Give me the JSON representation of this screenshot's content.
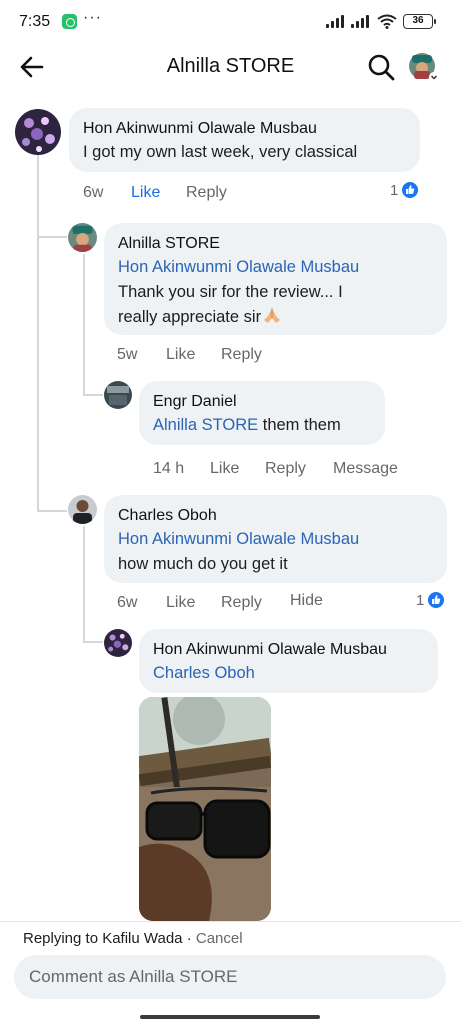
{
  "status_bar": {
    "time": "7:35",
    "more": "···",
    "battery": "36",
    "app_icon": "whatsapp-icon"
  },
  "header": {
    "title": "Alnilla STORE",
    "back_icon": "arrow-left-icon",
    "search_icon": "search-icon"
  },
  "comments": [
    {
      "author": "Hon Akinwunmi Olawale Musbau",
      "text": "I got my own last week, very classical",
      "time": "6w",
      "like": "Like",
      "reply": "Reply",
      "reactions": "1"
    },
    {
      "author": "Alnilla STORE",
      "mention": "Hon Akinwunmi Olawale Musbau",
      "text_line1": "Thank you sir for the review... I",
      "text_line2": "really appreciate sir",
      "emoji": "folded-hands-emoji",
      "time": "5w",
      "like": "Like",
      "reply": "Reply"
    },
    {
      "author": "Engr Daniel",
      "mention": "Alnilla STORE",
      "text": " them them",
      "time": "14 h",
      "like": "Like",
      "reply": "Reply",
      "message": "Message"
    },
    {
      "author": "Charles Oboh",
      "mention": "Hon Akinwunmi Olawale Musbau",
      "text": "how much do you get it",
      "time": "6w",
      "like": "Like",
      "reply": "Reply",
      "hide": "Hide",
      "reactions": "1"
    },
    {
      "author": "Hon Akinwunmi Olawale Musbau",
      "mention": "Charles Oboh",
      "attachment": "photo of sunglasses held in hand"
    }
  ],
  "footer": {
    "replying_prefix": "Replying to Kafilu Wada",
    "separator": " · ",
    "cancel": "Cancel",
    "placeholder": "Comment as Alnilla STORE"
  },
  "colors": {
    "link": "#2a64b5",
    "like_active": "#1a6ee6",
    "bubble": "#eff2f5",
    "muted": "#65676b",
    "like_badge": "#1877f2"
  }
}
